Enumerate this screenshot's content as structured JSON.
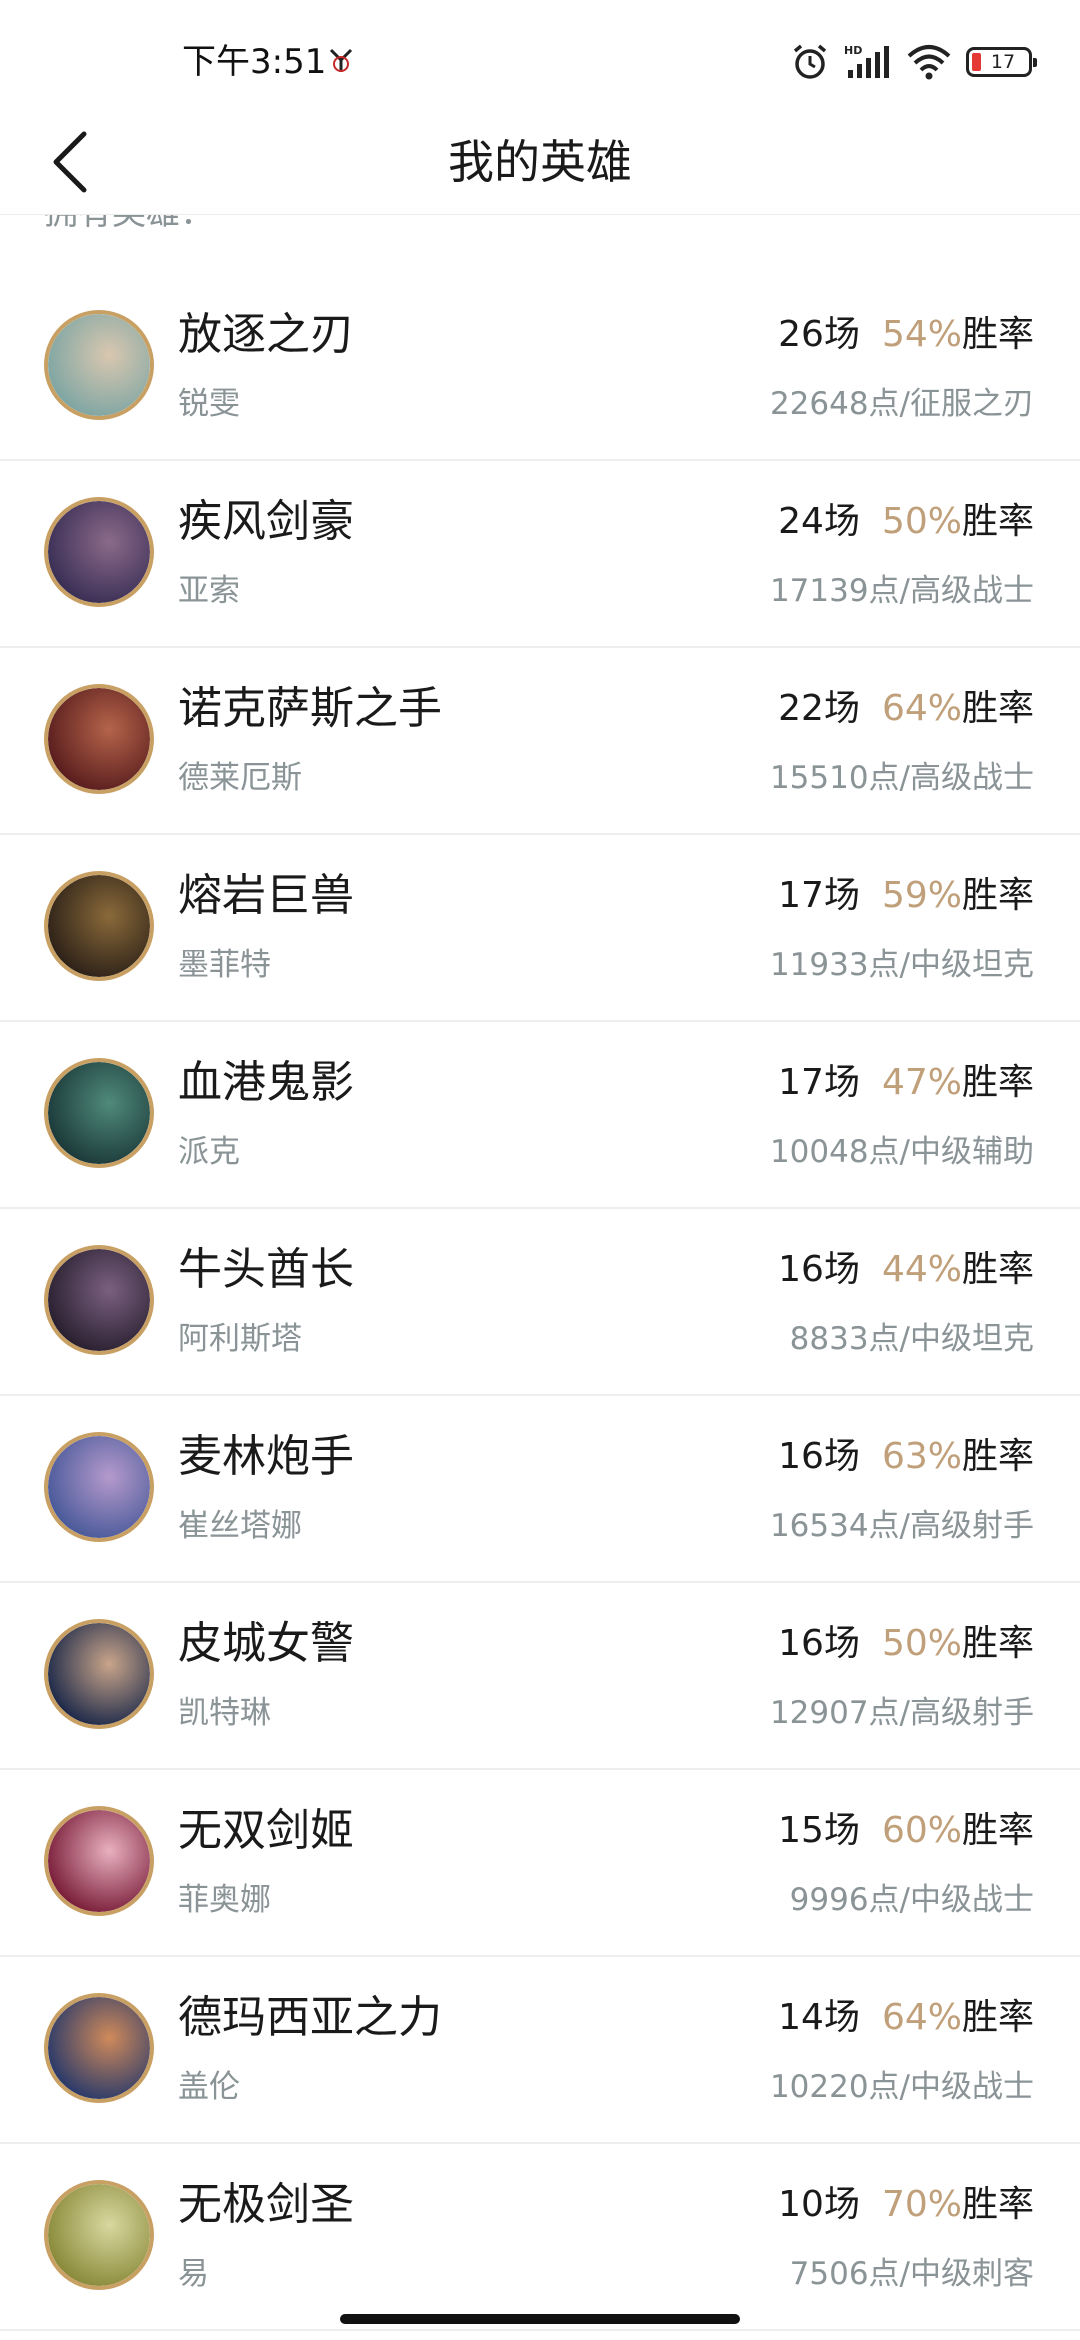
{
  "status_bar": {
    "time": "下午3:51",
    "battery_level": "17",
    "icons": [
      "alarm-icon",
      "hd-signal-icon",
      "wifi-icon",
      "battery-icon"
    ]
  },
  "header": {
    "title": "我的英雄",
    "back_icon": "chevron-left-icon"
  },
  "section_label": "拥有英雄：",
  "colors": {
    "win_rate": "#c0a07a",
    "avatar_border": "#c9a063",
    "secondary_text": "#8a9396"
  },
  "heroes": [
    {
      "title": "放逐之刃",
      "name": "锐雯",
      "games": "26场",
      "win_rate": "54%",
      "win_label": "胜率",
      "points": "22648点/征服之刃",
      "avatar_colors": [
        "#7fa6a3",
        "#d9c7b0"
      ]
    },
    {
      "title": "疾风剑豪",
      "name": "亚索",
      "games": "24场",
      "win_rate": "50%",
      "win_label": "胜率",
      "points": "17139点/高级战士",
      "avatar_colors": [
        "#3a2f55",
        "#8b6a8a"
      ]
    },
    {
      "title": "诺克萨斯之手",
      "name": "德莱厄斯",
      "games": "22场",
      "win_rate": "64%",
      "win_label": "胜率",
      "points": "15510点/高级战士",
      "avatar_colors": [
        "#5a1e1e",
        "#b5644a"
      ]
    },
    {
      "title": "熔岩巨兽",
      "name": "墨菲特",
      "games": "17场",
      "win_rate": "59%",
      "win_label": "胜率",
      "points": "11933点/中级坦克",
      "avatar_colors": [
        "#2e2218",
        "#8a6a3a"
      ]
    },
    {
      "title": "血港鬼影",
      "name": "派克",
      "games": "17场",
      "win_rate": "47%",
      "win_label": "胜率",
      "points": "10048点/中级辅助",
      "avatar_colors": [
        "#1c3a3a",
        "#4f8a7a"
      ]
    },
    {
      "title": "牛头酋长",
      "name": "阿利斯塔",
      "games": "16场",
      "win_rate": "44%",
      "win_label": "胜率",
      "points": "8833点/中级坦克",
      "avatar_colors": [
        "#2a2030",
        "#7a6080"
      ]
    },
    {
      "title": "麦林炮手",
      "name": "崔丝塔娜",
      "games": "16场",
      "win_rate": "63%",
      "win_label": "胜率",
      "points": "16534点/高级射手",
      "avatar_colors": [
        "#4a5a9a",
        "#b59acc"
      ]
    },
    {
      "title": "皮城女警",
      "name": "凯特琳",
      "games": "16场",
      "win_rate": "50%",
      "win_label": "胜率",
      "points": "12907点/高级射手",
      "avatar_colors": [
        "#1e2a4a",
        "#c9a58a"
      ]
    },
    {
      "title": "无双剑姬",
      "name": "菲奥娜",
      "games": "15场",
      "win_rate": "60%",
      "win_label": "胜率",
      "points": "9996点/中级战士",
      "avatar_colors": [
        "#7a1e3a",
        "#e8b0c0"
      ]
    },
    {
      "title": "德玛西亚之力",
      "name": "盖伦",
      "games": "14场",
      "win_rate": "64%",
      "win_label": "胜率",
      "points": "10220点/中级战士",
      "avatar_colors": [
        "#2a3a6a",
        "#d08a5a"
      ]
    },
    {
      "title": "无极剑圣",
      "name": "易",
      "games": "10场",
      "win_rate": "70%",
      "win_label": "胜率",
      "points": "7506点/中级刺客",
      "avatar_colors": [
        "#8a8a3a",
        "#d8d8a0"
      ]
    }
  ]
}
